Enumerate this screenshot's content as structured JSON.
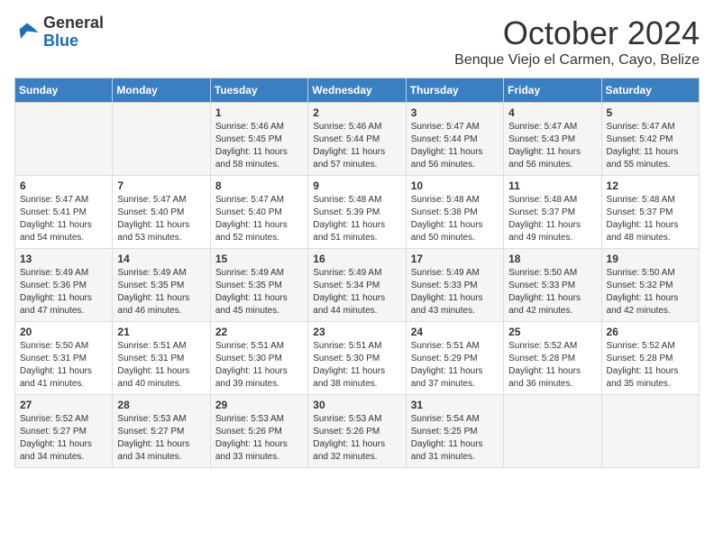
{
  "header": {
    "logo_general": "General",
    "logo_blue": "Blue",
    "month_title": "October 2024",
    "subtitle": "Benque Viejo el Carmen, Cayo, Belize"
  },
  "calendar": {
    "weekdays": [
      "Sunday",
      "Monday",
      "Tuesday",
      "Wednesday",
      "Thursday",
      "Friday",
      "Saturday"
    ],
    "weeks": [
      [
        {
          "day": "",
          "info": ""
        },
        {
          "day": "",
          "info": ""
        },
        {
          "day": "1",
          "info": "Sunrise: 5:46 AM\nSunset: 5:45 PM\nDaylight: 11 hours and 58 minutes."
        },
        {
          "day": "2",
          "info": "Sunrise: 5:46 AM\nSunset: 5:44 PM\nDaylight: 11 hours and 57 minutes."
        },
        {
          "day": "3",
          "info": "Sunrise: 5:47 AM\nSunset: 5:44 PM\nDaylight: 11 hours and 56 minutes."
        },
        {
          "day": "4",
          "info": "Sunrise: 5:47 AM\nSunset: 5:43 PM\nDaylight: 11 hours and 56 minutes."
        },
        {
          "day": "5",
          "info": "Sunrise: 5:47 AM\nSunset: 5:42 PM\nDaylight: 11 hours and 55 minutes."
        }
      ],
      [
        {
          "day": "6",
          "info": "Sunrise: 5:47 AM\nSunset: 5:41 PM\nDaylight: 11 hours and 54 minutes."
        },
        {
          "day": "7",
          "info": "Sunrise: 5:47 AM\nSunset: 5:40 PM\nDaylight: 11 hours and 53 minutes."
        },
        {
          "day": "8",
          "info": "Sunrise: 5:47 AM\nSunset: 5:40 PM\nDaylight: 11 hours and 52 minutes."
        },
        {
          "day": "9",
          "info": "Sunrise: 5:48 AM\nSunset: 5:39 PM\nDaylight: 11 hours and 51 minutes."
        },
        {
          "day": "10",
          "info": "Sunrise: 5:48 AM\nSunset: 5:38 PM\nDaylight: 11 hours and 50 minutes."
        },
        {
          "day": "11",
          "info": "Sunrise: 5:48 AM\nSunset: 5:37 PM\nDaylight: 11 hours and 49 minutes."
        },
        {
          "day": "12",
          "info": "Sunrise: 5:48 AM\nSunset: 5:37 PM\nDaylight: 11 hours and 48 minutes."
        }
      ],
      [
        {
          "day": "13",
          "info": "Sunrise: 5:49 AM\nSunset: 5:36 PM\nDaylight: 11 hours and 47 minutes."
        },
        {
          "day": "14",
          "info": "Sunrise: 5:49 AM\nSunset: 5:35 PM\nDaylight: 11 hours and 46 minutes."
        },
        {
          "day": "15",
          "info": "Sunrise: 5:49 AM\nSunset: 5:35 PM\nDaylight: 11 hours and 45 minutes."
        },
        {
          "day": "16",
          "info": "Sunrise: 5:49 AM\nSunset: 5:34 PM\nDaylight: 11 hours and 44 minutes."
        },
        {
          "day": "17",
          "info": "Sunrise: 5:49 AM\nSunset: 5:33 PM\nDaylight: 11 hours and 43 minutes."
        },
        {
          "day": "18",
          "info": "Sunrise: 5:50 AM\nSunset: 5:33 PM\nDaylight: 11 hours and 42 minutes."
        },
        {
          "day": "19",
          "info": "Sunrise: 5:50 AM\nSunset: 5:32 PM\nDaylight: 11 hours and 42 minutes."
        }
      ],
      [
        {
          "day": "20",
          "info": "Sunrise: 5:50 AM\nSunset: 5:31 PM\nDaylight: 11 hours and 41 minutes."
        },
        {
          "day": "21",
          "info": "Sunrise: 5:51 AM\nSunset: 5:31 PM\nDaylight: 11 hours and 40 minutes."
        },
        {
          "day": "22",
          "info": "Sunrise: 5:51 AM\nSunset: 5:30 PM\nDaylight: 11 hours and 39 minutes."
        },
        {
          "day": "23",
          "info": "Sunrise: 5:51 AM\nSunset: 5:30 PM\nDaylight: 11 hours and 38 minutes."
        },
        {
          "day": "24",
          "info": "Sunrise: 5:51 AM\nSunset: 5:29 PM\nDaylight: 11 hours and 37 minutes."
        },
        {
          "day": "25",
          "info": "Sunrise: 5:52 AM\nSunset: 5:28 PM\nDaylight: 11 hours and 36 minutes."
        },
        {
          "day": "26",
          "info": "Sunrise: 5:52 AM\nSunset: 5:28 PM\nDaylight: 11 hours and 35 minutes."
        }
      ],
      [
        {
          "day": "27",
          "info": "Sunrise: 5:52 AM\nSunset: 5:27 PM\nDaylight: 11 hours and 34 minutes."
        },
        {
          "day": "28",
          "info": "Sunrise: 5:53 AM\nSunset: 5:27 PM\nDaylight: 11 hours and 34 minutes."
        },
        {
          "day": "29",
          "info": "Sunrise: 5:53 AM\nSunset: 5:26 PM\nDaylight: 11 hours and 33 minutes."
        },
        {
          "day": "30",
          "info": "Sunrise: 5:53 AM\nSunset: 5:26 PM\nDaylight: 11 hours and 32 minutes."
        },
        {
          "day": "31",
          "info": "Sunrise: 5:54 AM\nSunset: 5:25 PM\nDaylight: 11 hours and 31 minutes."
        },
        {
          "day": "",
          "info": ""
        },
        {
          "day": "",
          "info": ""
        }
      ]
    ]
  }
}
